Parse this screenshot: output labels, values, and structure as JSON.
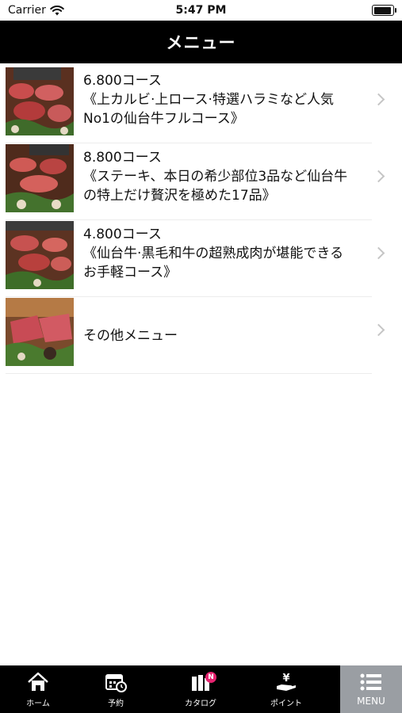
{
  "status_bar": {
    "carrier": "Carrier",
    "time": "5:47 PM",
    "battery_level": 0.95
  },
  "header": {
    "title": "メニュー"
  },
  "menu": {
    "items": [
      {
        "title": "6.800コース",
        "desc_line1": "《上カルビ·上ロース·特選ハラミなど人気",
        "desc_line2": "No1の仙台牛フルコース》",
        "thumbnail_icon": "yakiniku-course-photo"
      },
      {
        "title": "8.800コース",
        "desc_line1": "《ステーキ、本日の希少部位3品など仙台牛",
        "desc_line2": "の特上だけ贅沢を極めた17品》",
        "thumbnail_icon": "yakiniku-course-photo"
      },
      {
        "title": "4.800コース",
        "desc_line1": "《仙台牛·黒毛和牛の超熟成肉が堪能できる",
        "desc_line2": "お手軽コース》",
        "thumbnail_icon": "yakiniku-course-photo"
      },
      {
        "title": "その他メニュー",
        "thumbnail_icon": "raw-beef-photo"
      }
    ]
  },
  "tab_bar": {
    "active_color": "#9a9ea3",
    "tabs": [
      {
        "label": "ホーム",
        "icon": "home-icon"
      },
      {
        "label": "予約",
        "icon": "calendar-clock-icon"
      },
      {
        "label": "カタログ",
        "icon": "catalog-icon",
        "badge": "N"
      },
      {
        "label": "ポイント",
        "icon": "yen-hand-icon"
      },
      {
        "label": "MENU",
        "icon": "list-icon",
        "active": true
      }
    ]
  }
}
